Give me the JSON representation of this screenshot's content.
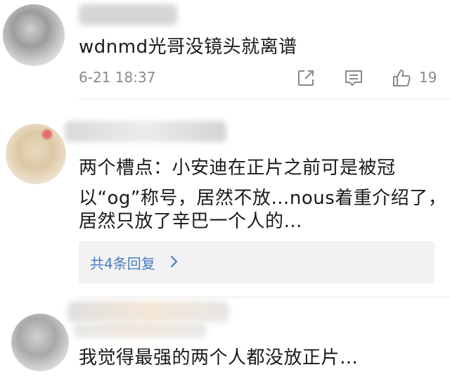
{
  "comments": [
    {
      "text": "wdnmd光哥没镜头就离谱",
      "time": "6-21 18:37",
      "like_count": "19",
      "icons": [
        "share-icon",
        "comment-icon",
        "like-icon"
      ]
    },
    {
      "lines": [
        "两个槽点：小安迪在正片之前可是被冠",
        "以“og”称号，居然不放…nous着重介绍了，",
        "居然只放了辛巴一个人的…"
      ],
      "replies_label": "共4条回复"
    },
    {
      "text": "我觉得最强的两个人都没放正片…"
    }
  ],
  "colors": {
    "meta_gray": "#8a8a8a",
    "reply_link": "#4a7cbf",
    "reply_bg": "#f2f2f2"
  }
}
